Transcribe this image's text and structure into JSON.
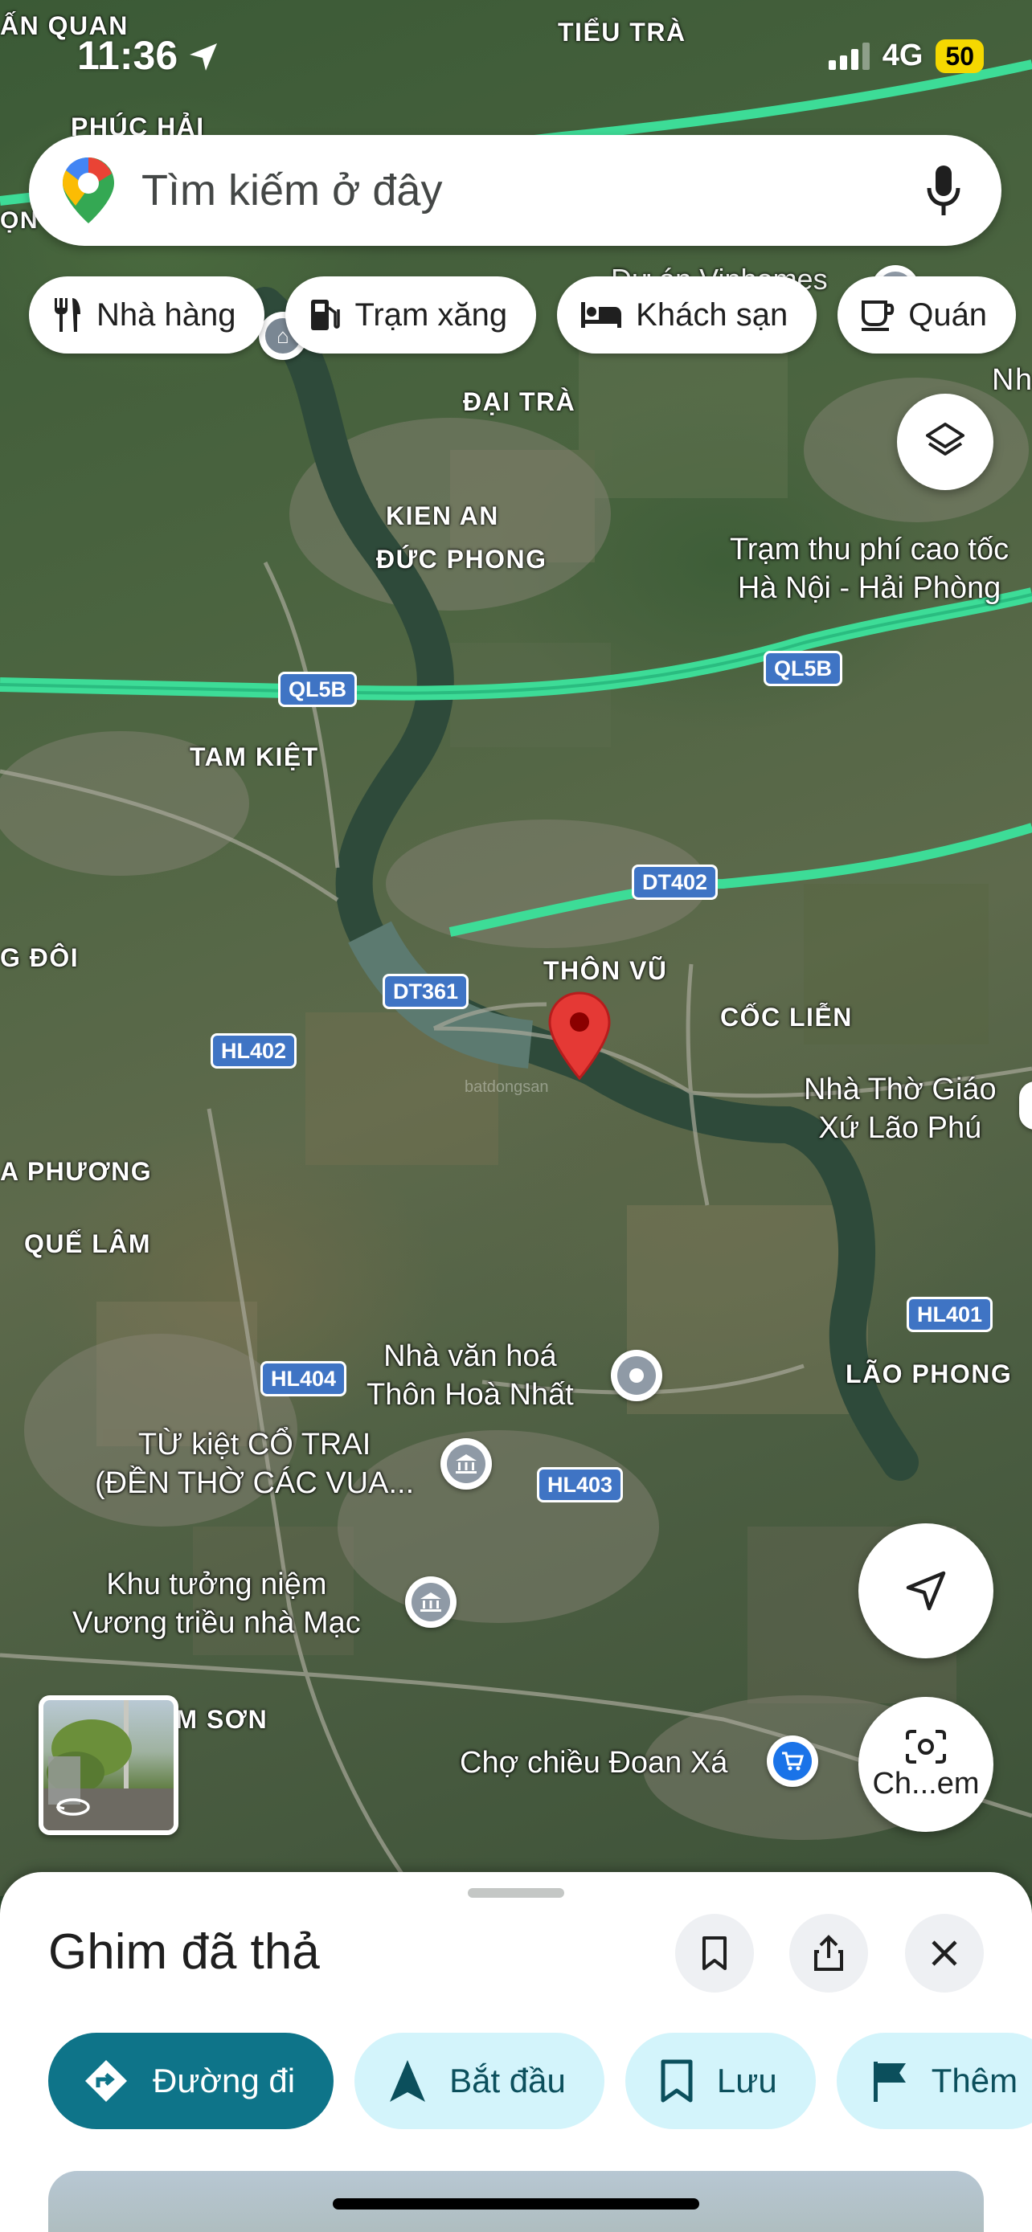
{
  "status_bar": {
    "time": "11:36",
    "network": "4G",
    "battery": "50"
  },
  "search": {
    "placeholder": "Tìm kiếm ở đây"
  },
  "chips": [
    {
      "label": "Nhà hàng",
      "icon": "fork-knife-icon"
    },
    {
      "label": "Trạm xăng",
      "icon": "gas-station-icon"
    },
    {
      "label": "Khách sạn",
      "icon": "bed-icon"
    },
    {
      "label": "Quán",
      "icon": "coffee-cup-icon"
    }
  ],
  "map": {
    "places": [
      "ẤN QUAN",
      "TIỂU TRÀ",
      "PHÚC HẢI",
      "ĐẠI TRÀ",
      "KIEN AN",
      "ĐỨC PHONG",
      "TAM KIỆT",
      "THÔN VŨ",
      "CỐC LIỄN",
      "G ĐÔI",
      "A PHƯƠNG",
      "QUẾ LÂM",
      "LÃO PHONG",
      "IM SƠN",
      "Nh",
      "ỌN"
    ],
    "poi_labels": {
      "toll": "Trạm thu phí cao tốc\nHà Nội - Hải Phòng",
      "church": "Nhà Thờ Giáo\nXứ Lão Phú",
      "culture_house": "Nhà văn hoá\nThôn Hoà Nhất",
      "temple": "TỪ kiệt CỔ TRAI\n(ĐỀN THỜ CÁC VUA...",
      "memorial": "Khu tưởng niệm\nVương triều nhà Mạc",
      "market": "Chợ chiều Đoan Xá",
      "vinhomes": "Dự án Vinhomes"
    },
    "roads": [
      "QL5B",
      "QL5B",
      "DT402",
      "DT361",
      "HL402",
      "HL401",
      "HL404",
      "HL403"
    ],
    "watermark": "batdongsan"
  },
  "controls": {
    "camera_label": "Ch...em"
  },
  "sheet": {
    "title": "Ghim đã thả",
    "actions": [
      {
        "label": "Đường đi",
        "icon": "directions-icon"
      },
      {
        "label": "Bắt đầu",
        "icon": "navigation-arrow-icon"
      },
      {
        "label": "Lưu",
        "icon": "bookmark-icon"
      },
      {
        "label": "Thêm",
        "icon": "flag-icon"
      }
    ]
  },
  "colors": {
    "accent": "#0e7489",
    "chip_tonal": "#d3f4fb",
    "road_shield": "#3f74c4",
    "pin": "#d93025"
  }
}
